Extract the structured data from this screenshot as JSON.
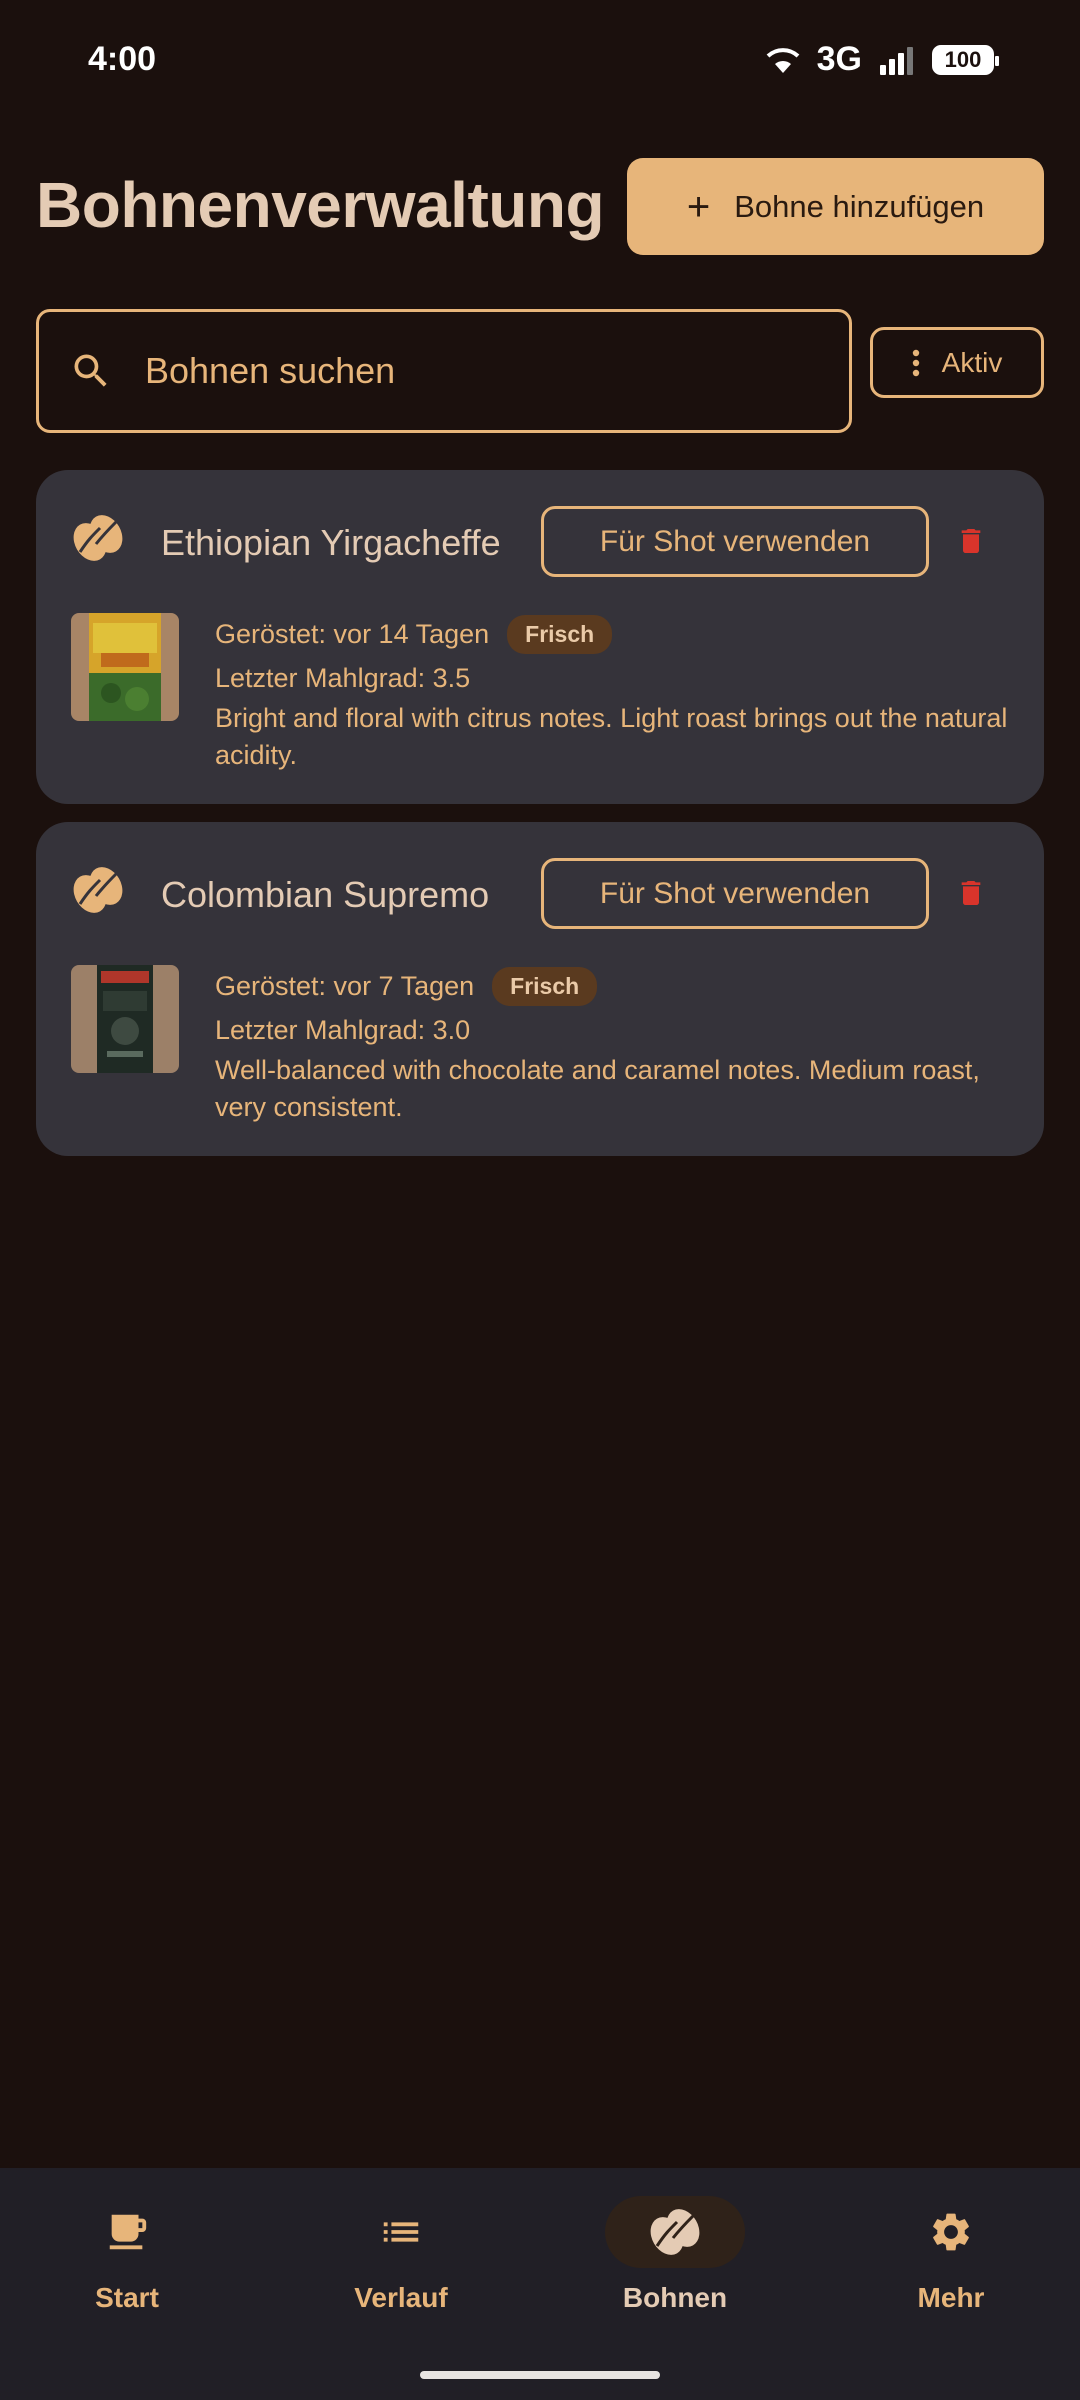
{
  "status": {
    "time": "4:00",
    "network": "3G",
    "battery": "100"
  },
  "header": {
    "title": "Bohnenverwaltung",
    "add_button_label": "Bohne hinzufügen"
  },
  "search": {
    "placeholder": "Bohnen suchen",
    "value": "",
    "filter_label": "Aktiv"
  },
  "beans": [
    {
      "name": "Ethiopian Yirgacheffe",
      "use_label": "Für Shot verwenden",
      "roasted": "Geröstet: vor 14 Tagen",
      "badge": "Frisch",
      "grind": "Letzter Mahlgrad: 3.5",
      "notes": "Bright and floral with citrus notes. Light roast brings out the natural acidity."
    },
    {
      "name": "Colombian Supremo",
      "use_label": "Für Shot verwenden",
      "roasted": "Geröstet: vor 7 Tagen",
      "badge": "Frisch",
      "grind": "Letzter Mahlgrad: 3.0",
      "notes": "Well-balanced with chocolate and caramel notes. Medium roast, very consistent."
    }
  ],
  "nav": {
    "items": [
      {
        "label": "Start",
        "icon": "coffee-cup-icon"
      },
      {
        "label": "Verlauf",
        "icon": "list-icon"
      },
      {
        "label": "Bohnen",
        "icon": "coffee-bean-icon",
        "active": true
      },
      {
        "label": "Mehr",
        "icon": "gear-icon"
      }
    ]
  },
  "colors": {
    "accent": "#e7b57a",
    "background": "#1b100d",
    "card": "#35333a",
    "danger": "#d9342b"
  }
}
